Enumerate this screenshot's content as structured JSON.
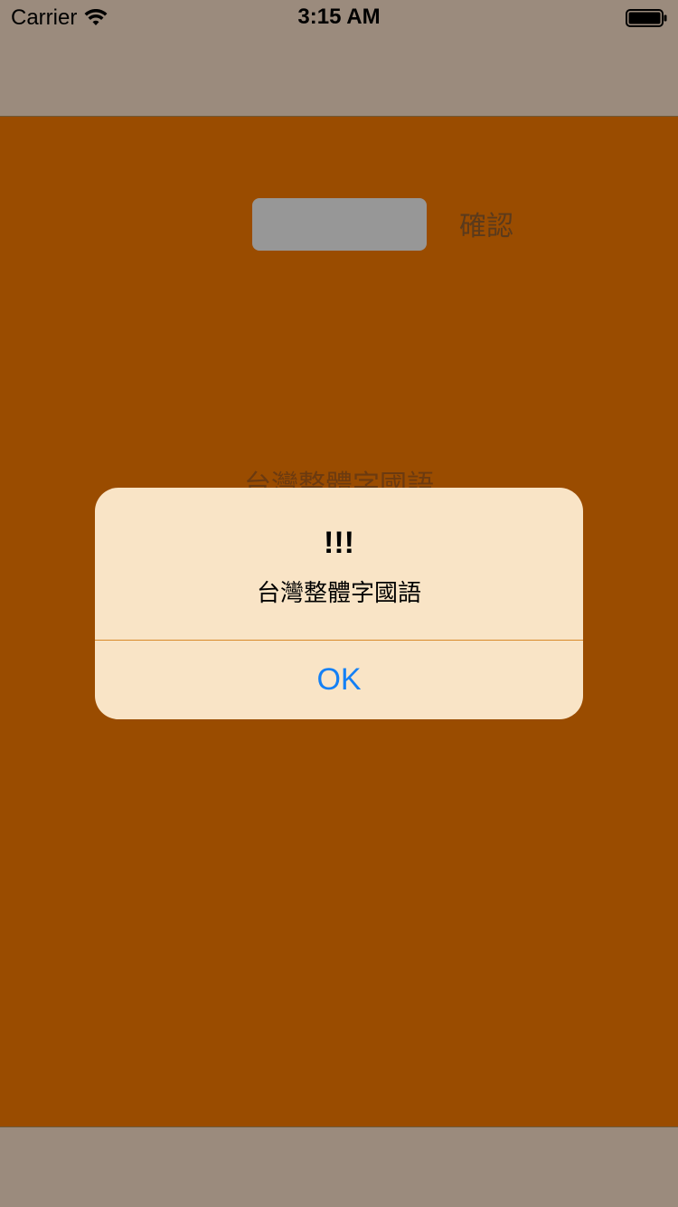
{
  "status_bar": {
    "carrier": "Carrier",
    "time": "3:15 AM",
    "icons": [
      "wifi-icon",
      "battery-icon"
    ]
  },
  "main": {
    "input": {
      "value": "",
      "placeholder": ""
    },
    "confirm_label": "確認",
    "result_text": "台灣整體字國語"
  },
  "alert": {
    "title": "!!!",
    "message": "台灣整體字國語",
    "ok_label": "OK"
  },
  "colors": {
    "background": "#9a4c00",
    "bars": "#9b8b7d",
    "alert_background": "#f9e4c6",
    "alert_button": "#1480f5",
    "input_background": "#979797"
  }
}
